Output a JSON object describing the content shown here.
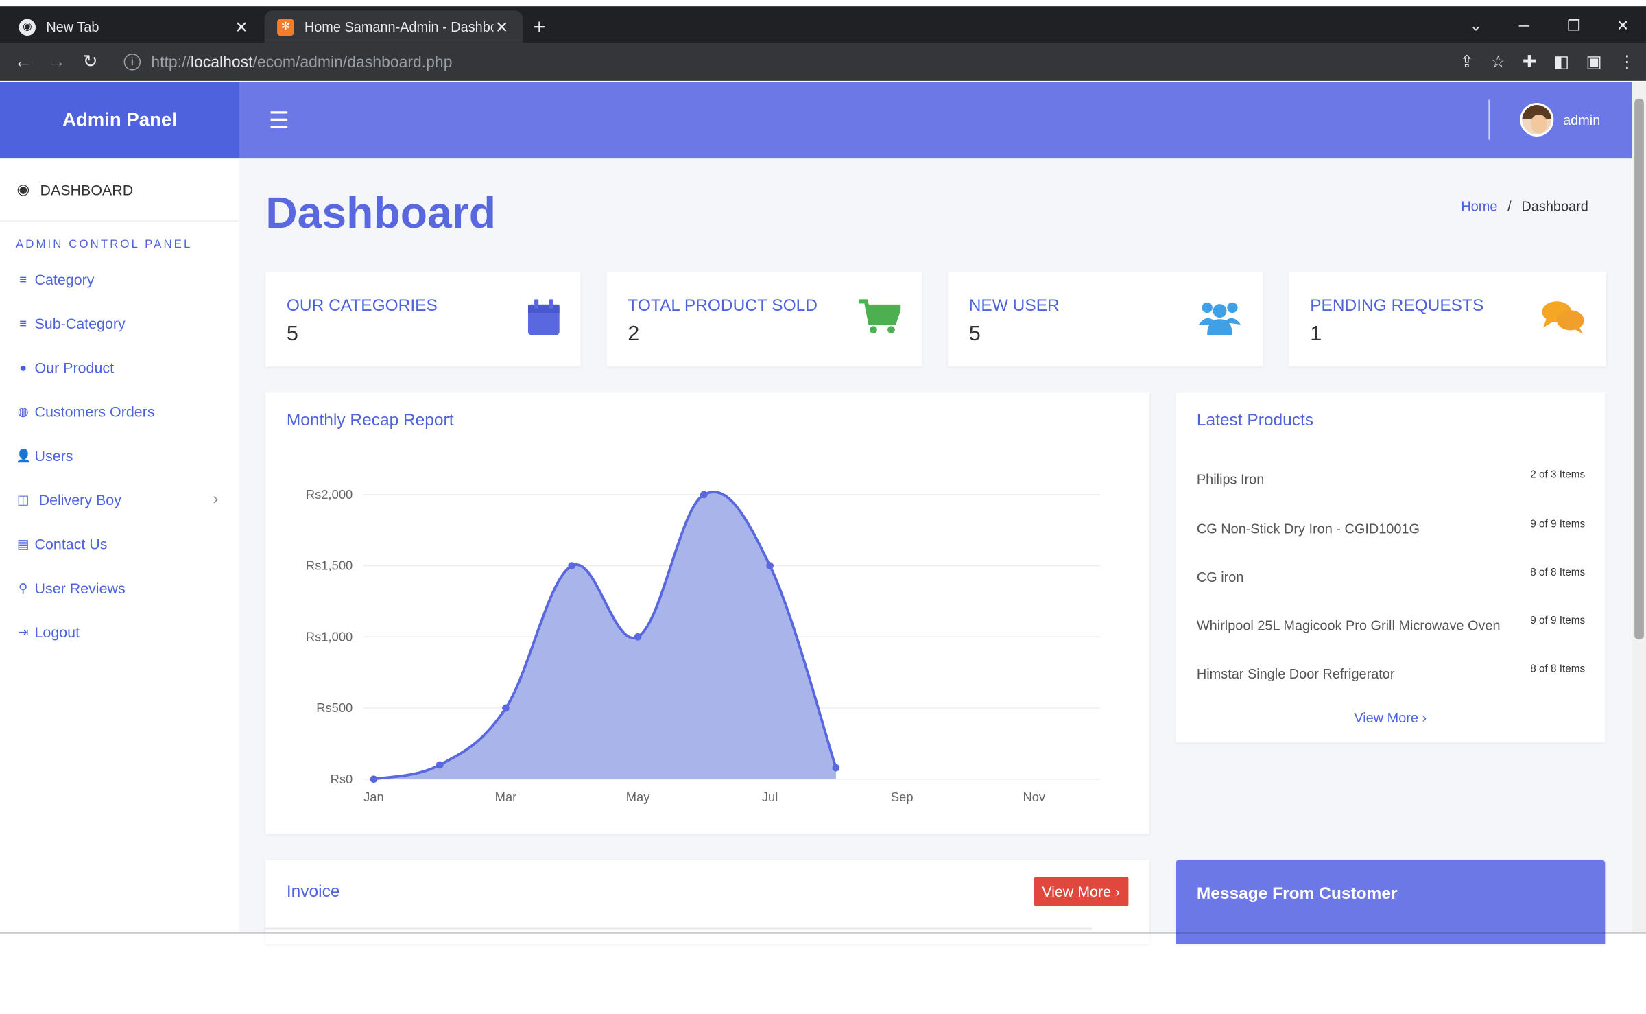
{
  "browser": {
    "tabs": [
      {
        "title": "New Tab"
      },
      {
        "title": "Home Samann-Admin - Dashboard"
      }
    ],
    "url_prefix": "http://",
    "url_host": "localhost",
    "url_path": "/ecom/admin/dashboard.php"
  },
  "sidebar": {
    "brand": "Admin Panel",
    "dashboard_label": "DASHBOARD",
    "section_label": "ADMIN CONTROL PANEL",
    "items": [
      {
        "label": "Category",
        "icon": "list-icon"
      },
      {
        "label": "Sub-Category",
        "icon": "list-icon"
      },
      {
        "label": "Our Product",
        "icon": "circle-icon"
      },
      {
        "label": "Customers Orders",
        "icon": "orders-icon"
      },
      {
        "label": "Users",
        "icon": "user-icon"
      },
      {
        "label": "Delivery Boy",
        "icon": "table-icon"
      },
      {
        "label": "Contact Us",
        "icon": "contact-icon"
      },
      {
        "label": "User Reviews",
        "icon": "search-icon"
      },
      {
        "label": "Logout",
        "icon": "logout-icon"
      }
    ]
  },
  "header": {
    "user": "admin"
  },
  "page": {
    "title": "Dashboard",
    "breadcrumb_home": "Home",
    "breadcrumb_sep": "/",
    "breadcrumb_current": "Dashboard"
  },
  "stats": [
    {
      "label": "OUR CATEGORIES",
      "value": "5",
      "icon": "calendar-icon",
      "color": "#5a68e0"
    },
    {
      "label": "TOTAL PRODUCT SOLD",
      "value": "2",
      "icon": "cart-icon",
      "color": "#4caf50"
    },
    {
      "label": "NEW USER",
      "value": "5",
      "icon": "users-icon",
      "color": "#3fa0e6"
    },
    {
      "label": "PENDING REQUESTS",
      "value": "1",
      "icon": "chat-icon",
      "color": "#f5a623"
    }
  ],
  "chart_panel": {
    "title": "Monthly Recap Report"
  },
  "chart_data": {
    "type": "area",
    "x": [
      "Jan",
      "Feb",
      "Mar",
      "Apr",
      "May",
      "Jun",
      "Jul",
      "Aug"
    ],
    "values": [
      0,
      100,
      500,
      1500,
      1000,
      2000,
      1500,
      80
    ],
    "tick_labels_x": [
      "Jan",
      "Mar",
      "May",
      "Jul",
      "Sep",
      "Nov"
    ],
    "tick_labels_y": [
      "Rs0",
      "Rs500",
      "Rs1,000",
      "Rs1,500",
      "Rs2,000"
    ],
    "ylim": [
      0,
      2000
    ],
    "x_months_total": 11,
    "line_color": "#5a68e0",
    "fill_color": "#a9b5ea"
  },
  "latest_products": {
    "title": "Latest Products",
    "items": [
      {
        "name": "Philips Iron",
        "count": "2 of 3 Items"
      },
      {
        "name": "CG Non-Stick Dry Iron - CGID1001G",
        "count": "9 of 9 Items"
      },
      {
        "name": "CG iron",
        "count": "8 of 8 Items"
      },
      {
        "name": "Whirlpool 25L Magicook Pro Grill Microwave Oven",
        "count": "9 of 9 Items"
      },
      {
        "name": "Himstar Single Door Refrigerator",
        "count": "8 of 8 Items"
      }
    ],
    "view_more": "View More"
  },
  "invoice": {
    "title": "Invoice",
    "button": "View More"
  },
  "messages": {
    "title": "Message From Customer"
  }
}
